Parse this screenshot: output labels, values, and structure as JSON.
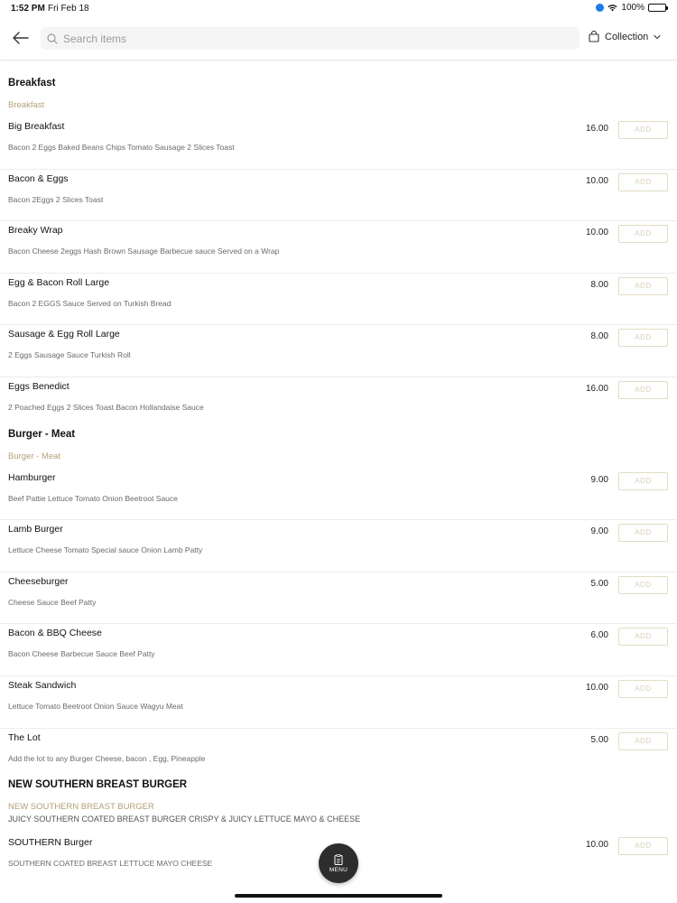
{
  "status_bar": {
    "time": "1:52 PM",
    "date": "Fri Feb 18",
    "battery": "100%"
  },
  "header": {
    "search_placeholder": "Search items",
    "collection_label": "Collection",
    "icons": {
      "back": "arrow-left-icon",
      "search": "search-icon",
      "bag": "shopping-bag-icon",
      "chevron": "chevron-down-icon"
    }
  },
  "sections": [
    {
      "title": "Breakfast",
      "subtitle": "Breakfast",
      "description": "",
      "items": [
        {
          "name": "Big Breakfast",
          "desc": "Bacon 2 Eggs Baked Beans Chips Tomato Sausage 2 Slices Toast",
          "price": "16.00",
          "add": "ADD"
        },
        {
          "name": "Bacon & Eggs",
          "desc": "Bacon 2Eggs 2 Slices Toast",
          "price": "10.00",
          "add": "ADD"
        },
        {
          "name": "Breaky Wrap",
          "desc": "Bacon Cheese 2eggs Hash Brown Sausage Barbecue sauce Served on a Wrap",
          "price": "10.00",
          "add": "ADD"
        },
        {
          "name": "Egg & Bacon Roll Large",
          "desc": "Bacon 2 EGGS Sauce Served on Turkish Bread",
          "price": "8.00",
          "add": "ADD"
        },
        {
          "name": "Sausage & Egg Roll Large",
          "desc": "2 Eggs Sausage Sauce Turkish Roll",
          "price": "8.00",
          "add": "ADD"
        },
        {
          "name": "Eggs Benedict",
          "desc": "2 Poached Eggs 2 Slices Toast Bacon Hollandaise Sauce",
          "price": "16.00",
          "add": "ADD"
        }
      ]
    },
    {
      "title": "Burger - Meat",
      "subtitle": "Burger - Meat",
      "description": "",
      "items": [
        {
          "name": "Hamburger",
          "desc": "Beef Pattie Lettuce Tomato Onion Beetroot Sauce",
          "price": "9.00",
          "add": "ADD"
        },
        {
          "name": "Lamb Burger",
          "desc": "Lettuce Cheese Tomato Special sauce Onion Lamb Patty",
          "price": "9.00",
          "add": "ADD"
        },
        {
          "name": "Cheeseburger",
          "desc": "Cheese Sauce Beef Patty",
          "price": "5.00",
          "add": "ADD"
        },
        {
          "name": "Bacon & BBQ Cheese",
          "desc": "Bacon Cheese Barbecue Sauce Beef Patty",
          "price": "6.00",
          "add": "ADD"
        },
        {
          "name": "Steak Sandwich",
          "desc": "Lettuce Tomato Beetroot Onion Sauce Wagyu Meat",
          "price": "10.00",
          "add": "ADD"
        },
        {
          "name": "The Lot",
          "desc": "Add the lot to any Burger Cheese, bacon , Egg, Pineapple",
          "price": "5.00",
          "add": "ADD"
        }
      ]
    },
    {
      "title": "NEW SOUTHERN BREAST BURGER",
      "subtitle": "NEW SOUTHERN BREAST BURGER",
      "description": "JUICY SOUTHERN COATED BREAST BURGER CRISPY & JUICY LETTUCE MAYO & CHEESE",
      "items": [
        {
          "name": "SOUTHERN Burger",
          "desc": "SOUTHERN COATED BREAST LETTUCE MAYO CHEESE",
          "price": "10.00",
          "add": "ADD"
        }
      ]
    }
  ],
  "menu_button": {
    "label": "MENU",
    "icon": "clipboard-icon"
  },
  "colors": {
    "accent_gold": "#b5a07a",
    "add_border": "#e3dcc2",
    "fab_bg": "#2d2d2d"
  }
}
